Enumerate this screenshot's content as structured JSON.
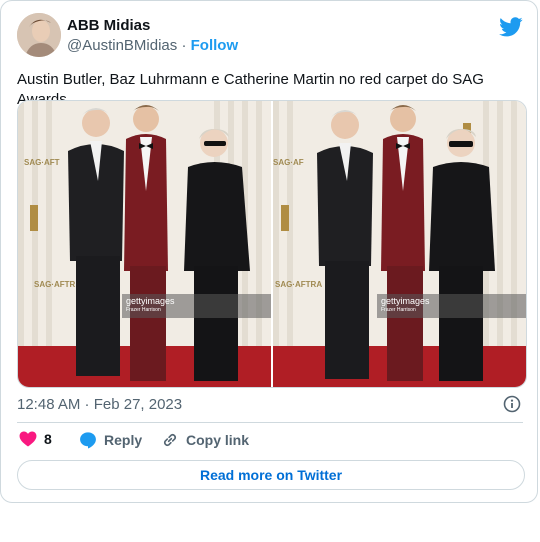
{
  "author": {
    "name": "ABB Midias",
    "handle": "@AustinBMidias",
    "separator": "·",
    "follow_label": "Follow"
  },
  "tweet": {
    "text": "Austin Butler, Baz Luhrmann e Catherine Martin no red carpet do SAG Awards."
  },
  "media": {
    "photos": [
      {
        "watermark": "gettyimages",
        "credit": "Frazer Harrison"
      },
      {
        "watermark": "gettyimages",
        "credit": "Frazer Harrison"
      }
    ],
    "backdrop_text": [
      "SAG-AFT",
      "SAG-AFTRA"
    ]
  },
  "meta": {
    "timestamp": "12:48 AM · Feb 27, 2023"
  },
  "actions": {
    "like_count": "8",
    "reply_label": "Reply",
    "copy_label": "Copy link"
  },
  "footer": {
    "read_more_label": "Read more on Twitter"
  },
  "colors": {
    "accent": "#1d9bf0",
    "like": "#f91880",
    "link": "#006fd6",
    "border": "#cfd9de",
    "muted": "#536471"
  }
}
